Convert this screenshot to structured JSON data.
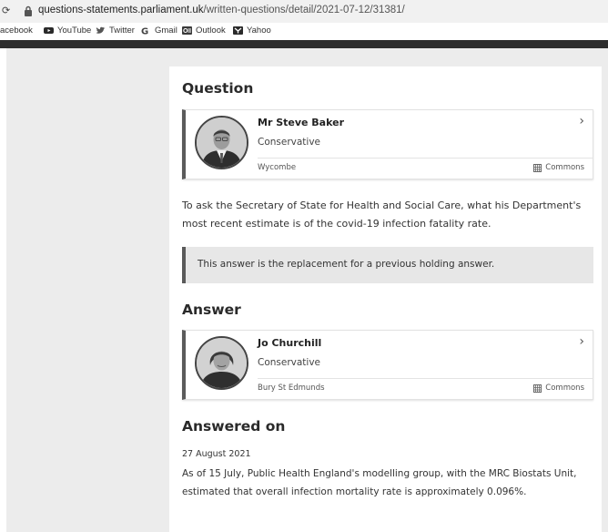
{
  "browser": {
    "nav_glyph": "⟳",
    "url_host": "questions-statements.parliament.uk",
    "url_path": "/written-questions/detail/2021-07-12/31381/"
  },
  "bookmarks": [
    {
      "label": "acebook",
      "icon": "facebook-icon"
    },
    {
      "label": "YouTube",
      "icon": "youtube-icon"
    },
    {
      "label": "Twitter",
      "icon": "twitter-icon"
    },
    {
      "label": "Gmail",
      "icon": "google-icon"
    },
    {
      "label": "Outlook",
      "icon": "outlook-icon"
    },
    {
      "label": "Yahoo",
      "icon": "yahoo-icon"
    }
  ],
  "question": {
    "heading": "Question",
    "member": {
      "name": "Mr Steve Baker",
      "party": "Conservative",
      "constituency": "Wycombe",
      "house": "Commons"
    },
    "text": "To ask the Secretary of State for Health and Social Care, what his Department's most recent estimate is of the covid-19 infection fatality rate."
  },
  "notice": {
    "text": "This answer is the replacement for a previous holding answer."
  },
  "answer": {
    "heading": "Answer",
    "member": {
      "name": "Jo Churchill",
      "party": "Conservative",
      "constituency": "Bury St Edmunds",
      "house": "Commons"
    }
  },
  "answered_on": {
    "heading": "Answered on",
    "date": "27 August 2021",
    "text": "As of 15 July, Public Health England's modelling group, with the MRC Biostats Unit, estimated that overall infection mortality rate is approximately 0.096%."
  },
  "colors": {
    "card_accent": "#5a5a5a",
    "notice_background": "#e7e7e7",
    "side_panel": "#ececec"
  }
}
